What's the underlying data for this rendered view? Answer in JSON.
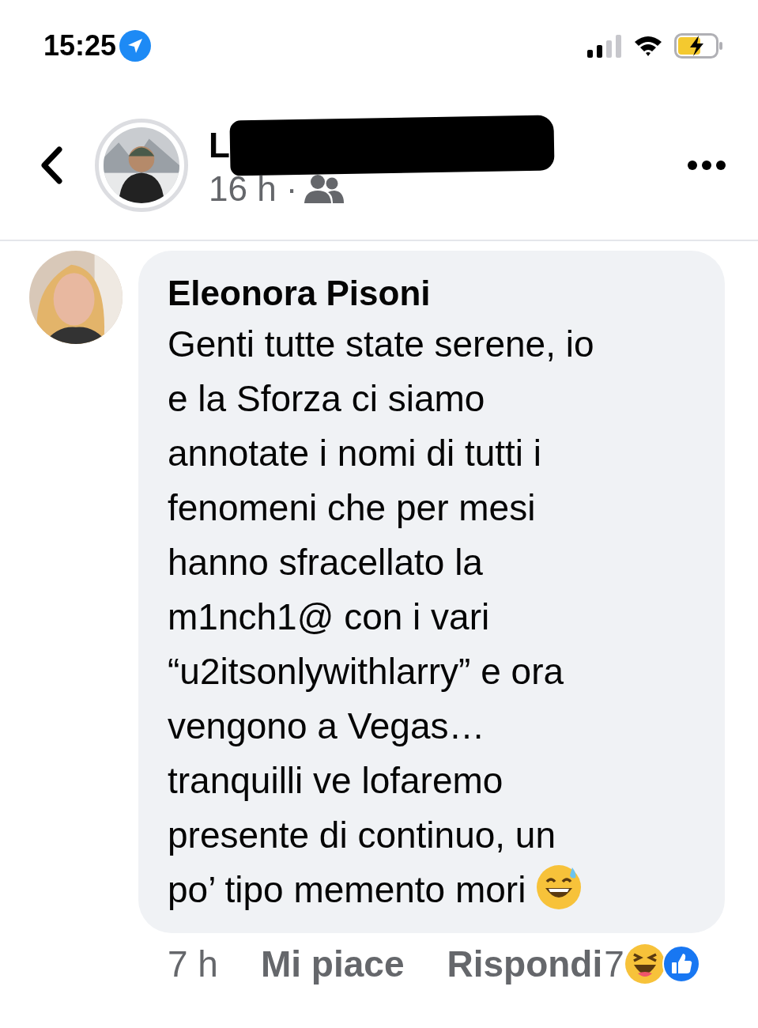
{
  "status_bar": {
    "time": "15:25"
  },
  "header": {
    "author": "L",
    "meta": "16 h ·"
  },
  "comment": {
    "author": "Eleonora Pisoni",
    "lines": [
      "Genti tutte state serene, io",
      "e la Sforza ci siamo",
      "annotate i nomi di tutti i",
      "fenomeni che per mesi",
      "hanno sfracellato la",
      "m1nch1@ con i vari",
      "“u2itsonlywithlarry” e ora",
      "vengono a Vegas…",
      "tranquilli ve lofaremo",
      "presente di continuo, un",
      "po’ tipo memento mori"
    ],
    "time": "7 h",
    "actions": [
      "Mi piace",
      "Rispondi"
    ],
    "reaction_count": "7"
  }
}
